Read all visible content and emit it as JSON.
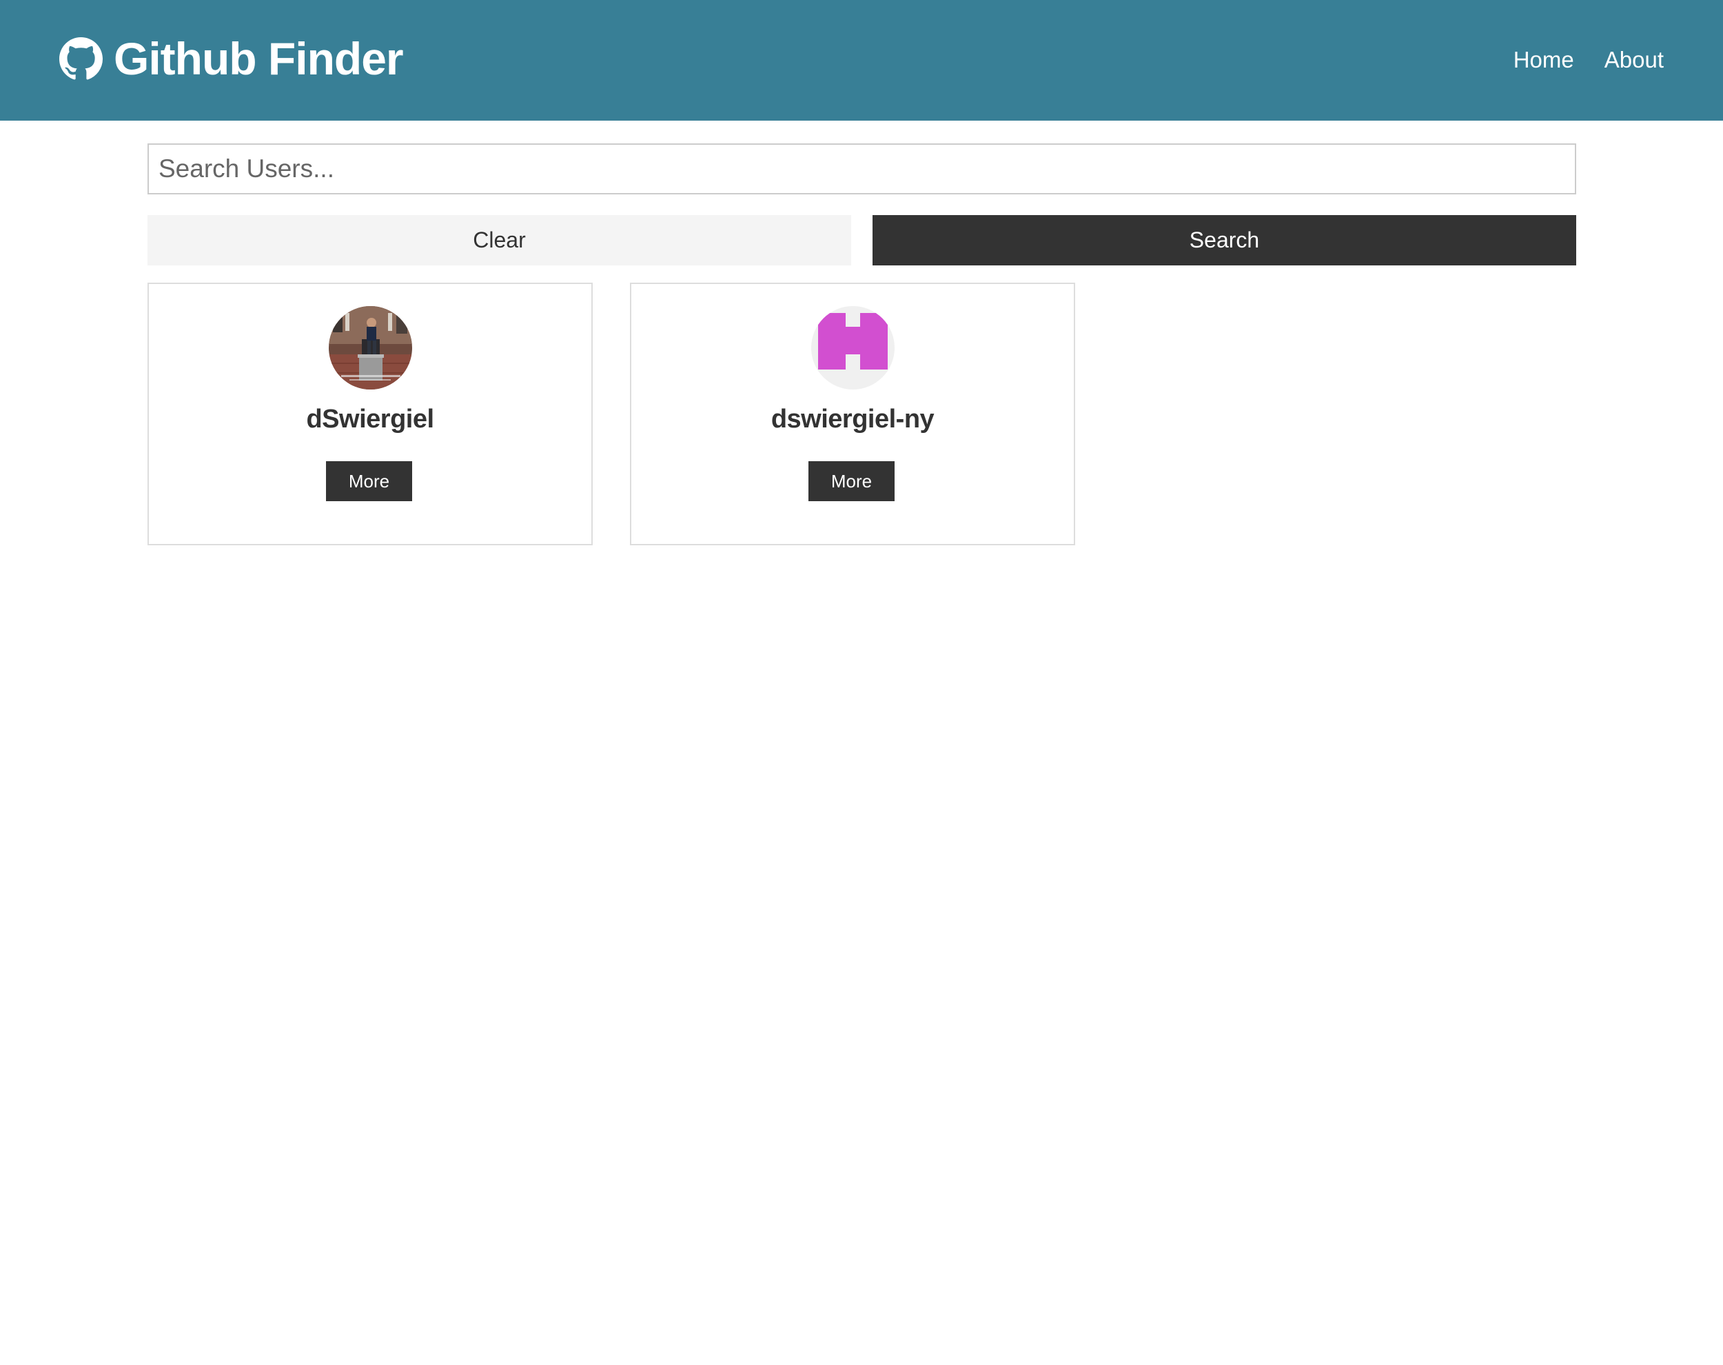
{
  "navbar": {
    "brand_icon": "github-icon",
    "title": "Github Finder",
    "links": [
      {
        "label": "Home"
      },
      {
        "label": "About"
      }
    ],
    "background_color": "#387f96"
  },
  "search": {
    "placeholder": "Search Users...",
    "value": "",
    "clear_label": "Clear",
    "search_label": "Search"
  },
  "users": [
    {
      "login": "dSwiergiel",
      "avatar": "photo-avatar",
      "more_label": "More"
    },
    {
      "login": "dswiergiel-ny",
      "avatar": "identicon-avatar",
      "more_label": "More"
    }
  ],
  "colors": {
    "primary": "#387f96",
    "dark": "#333333",
    "light": "#f4f4f4",
    "identicon": "#d24fd0"
  }
}
